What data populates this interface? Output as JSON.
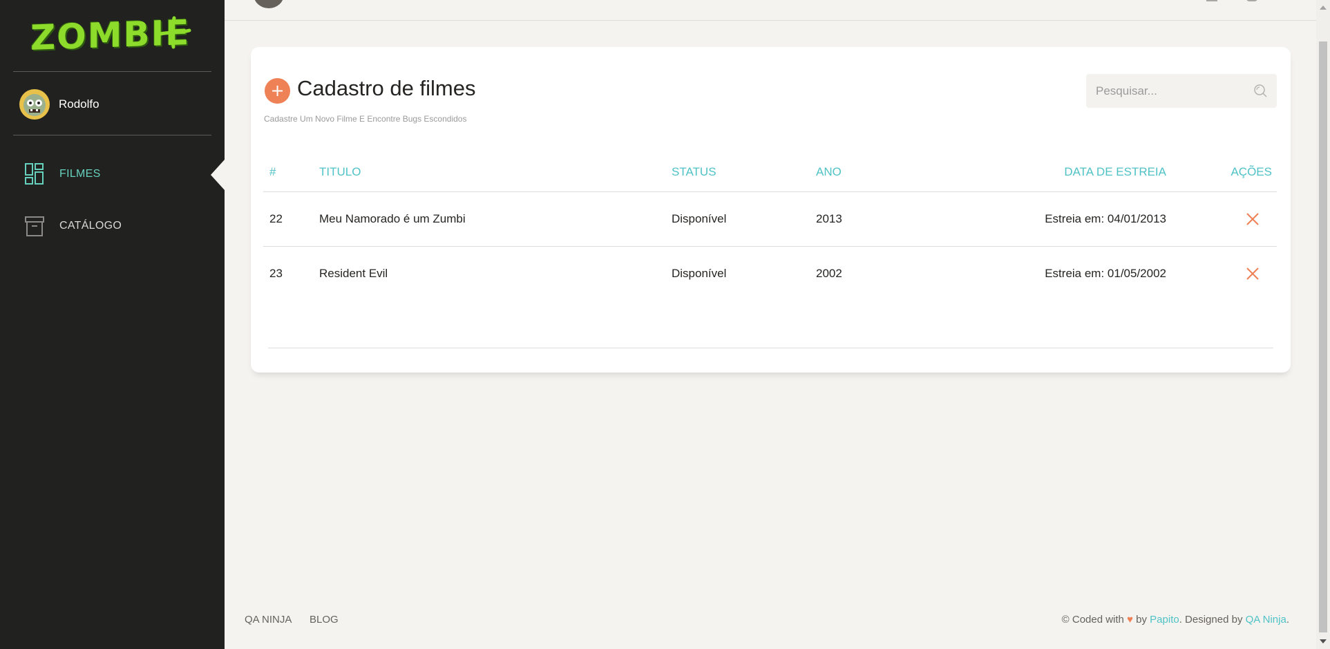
{
  "brand": {
    "logo_text": "ZOMBIE",
    "logo_mark": "plus-sign"
  },
  "user": {
    "name": "Rodolfo"
  },
  "sidebar": {
    "items": [
      {
        "label": "FILMES",
        "icon": "dashboard-icon",
        "active": true
      },
      {
        "label": "CATÁLOGO",
        "icon": "archive-box-icon",
        "active": false
      }
    ]
  },
  "page": {
    "title": "Cadastro de filmes",
    "subtitle": "Cadastre Um Novo Filme E Encontre Bugs Escondidos",
    "add_label": "+",
    "search_placeholder": "Pesquisar..."
  },
  "table": {
    "headers": [
      "#",
      "TITULO",
      "STATUS",
      "ANO",
      "DATA DE ESTREIA",
      "AÇÕES"
    ],
    "rows": [
      {
        "id": "22",
        "title": "Meu Namorado é um Zumbi",
        "status": "Disponível",
        "year": "2013",
        "release": "Estreia em: 04/01/2013"
      },
      {
        "id": "23",
        "title": "Resident Evil",
        "status": "Disponível",
        "year": "2002",
        "release": "Estreia em: 01/05/2002"
      }
    ]
  },
  "footer": {
    "links": [
      "QA NINJA",
      "BLOG"
    ],
    "credits_prefix": "© Coded with",
    "credits_by": "by",
    "author": "Papito",
    "designed_by": ". Designed by",
    "designer": "QA Ninja",
    "suffix": "."
  },
  "colors": {
    "accent": "#4fc2c6",
    "primary_orange": "#ef8157",
    "sidebar_bg": "#212120",
    "active_nav": "#66d2bd",
    "logo_green": "#8ddc2b"
  }
}
